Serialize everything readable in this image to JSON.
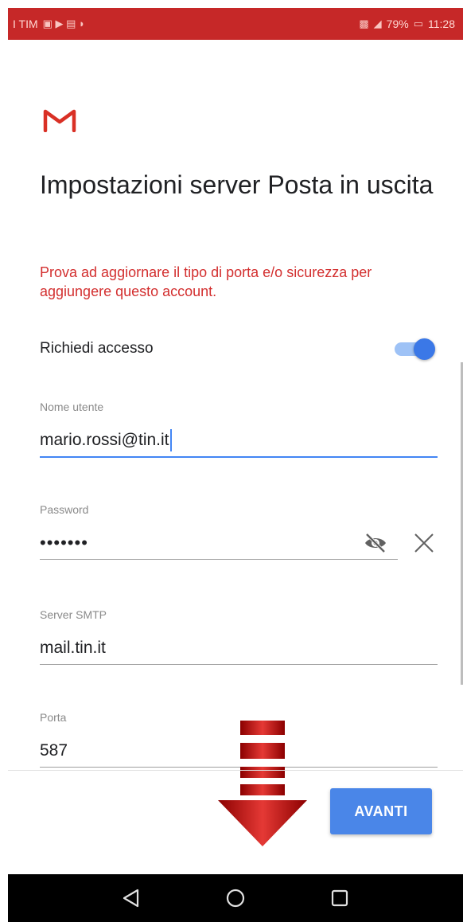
{
  "status_bar": {
    "carrier": "I TIM",
    "battery": "79%",
    "time": "11:28",
    "color": "#c62828"
  },
  "logo": {
    "name": "gmail-logo",
    "color": "#d93025"
  },
  "title": "Impostazioni server Posta in uscita",
  "error_message": "Prova ad aggiornare il tipo di porta e/o sicurezza per aggiungere questo account.",
  "require_login": {
    "label": "Richiedi accesso",
    "enabled": true
  },
  "fields": {
    "username": {
      "label": "Nome utente",
      "value": "mario.rossi@tin.it"
    },
    "password": {
      "label": "Password",
      "value": "•••••••"
    },
    "smtp_server": {
      "label": "Server SMTP",
      "value": "mail.tin.it"
    },
    "port": {
      "label": "Porta",
      "value": "587"
    }
  },
  "next_button": {
    "label": "AVANTI",
    "color": "#4a86e8"
  },
  "icons": {
    "eye": "eye-off-icon",
    "clear": "close-icon",
    "back": "back-triangle-icon",
    "home": "home-circle-icon",
    "recents": "recents-square-icon"
  }
}
